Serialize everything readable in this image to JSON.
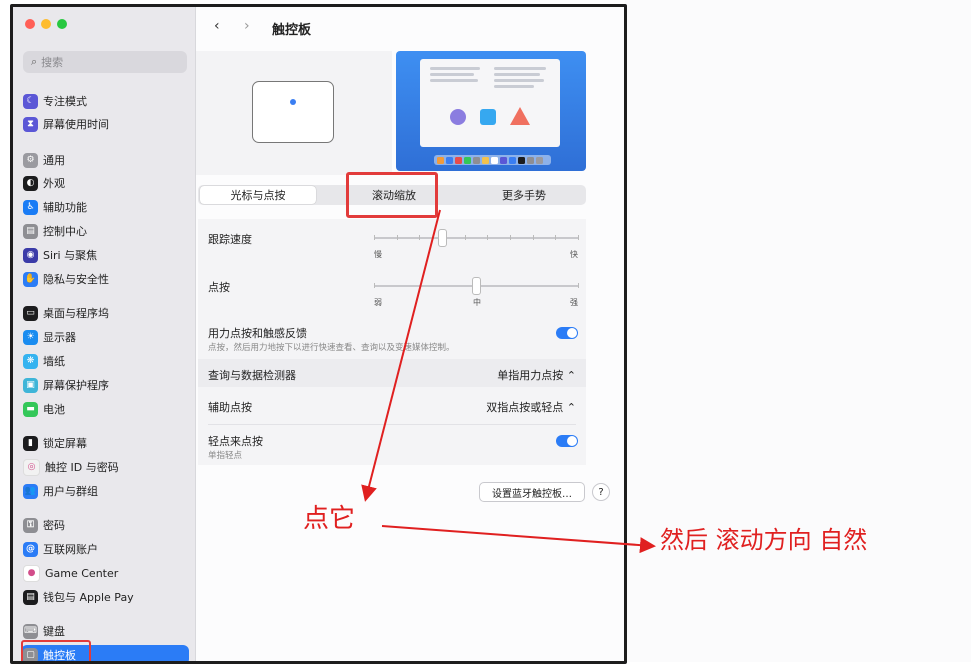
{
  "window": {
    "traffic_colors": [
      "#ff5f57",
      "#febc2e",
      "#28c840"
    ]
  },
  "sidebar": {
    "search_placeholder": "搜索",
    "items": [
      {
        "label": "专注模式",
        "icon": "moon-icon",
        "color": "#5b57d6",
        "glyph": "☾"
      },
      {
        "label": "屏幕使用时间",
        "icon": "hourglass-icon",
        "color": "#5b57d6",
        "glyph": "⧗"
      },
      {
        "label": "通用",
        "icon": "gear-icon",
        "color": "#9a9aa0",
        "glyph": "⚙"
      },
      {
        "label": "外观",
        "icon": "appearance-icon",
        "color": "#1c1c1e",
        "glyph": "◐"
      },
      {
        "label": "辅助功能",
        "icon": "accessibility-icon",
        "color": "#1a7cf5",
        "glyph": "♿"
      },
      {
        "label": "控制中心",
        "icon": "control-center-icon",
        "color": "#8e8e93",
        "glyph": "▤"
      },
      {
        "label": "Siri 与聚焦",
        "icon": "siri-icon",
        "color": "#3b3ba8",
        "glyph": "◉"
      },
      {
        "label": "隐私与安全性",
        "icon": "hand-icon",
        "color": "#2b7cf6",
        "glyph": "✋"
      },
      {
        "label": "桌面与程序坞",
        "icon": "dock-icon",
        "color": "#1c1c1e",
        "glyph": "▭"
      },
      {
        "label": "显示器",
        "icon": "display-icon",
        "color": "#1a8cf0",
        "glyph": "☀"
      },
      {
        "label": "墙纸",
        "icon": "wallpaper-icon",
        "color": "#35b3f0",
        "glyph": "❋"
      },
      {
        "label": "屏幕保护程序",
        "icon": "screensaver-icon",
        "color": "#3fb5d8",
        "glyph": "▣"
      },
      {
        "label": "电池",
        "icon": "battery-icon",
        "color": "#34c759",
        "glyph": "▬"
      },
      {
        "label": "锁定屏幕",
        "icon": "lock-screen-icon",
        "color": "#1c1c1e",
        "glyph": "▮"
      },
      {
        "label": "触控 ID 与密码",
        "icon": "fingerprint-icon",
        "color": "#f2f2f2",
        "glyph": "◎"
      },
      {
        "label": "用户与群组",
        "icon": "users-icon",
        "color": "#2b7cf6",
        "glyph": "👥"
      },
      {
        "label": "密码",
        "icon": "key-icon",
        "color": "#8e8e93",
        "glyph": "⚿"
      },
      {
        "label": "互联网账户",
        "icon": "at-icon",
        "color": "#2b7cf6",
        "glyph": "@"
      },
      {
        "label": "Game Center",
        "icon": "game-center-icon",
        "color": "#ffffff",
        "glyph": "●"
      },
      {
        "label": "钱包与 Apple Pay",
        "icon": "wallet-icon",
        "color": "#1c1c1e",
        "glyph": "▤"
      },
      {
        "label": "键盘",
        "icon": "keyboard-icon",
        "color": "#8e8e93",
        "glyph": "⌨"
      },
      {
        "label": "触控板",
        "icon": "trackpad-icon",
        "color": "#8e8e93",
        "glyph": "▢",
        "active": true
      }
    ]
  },
  "header": {
    "back": "‹",
    "forward": "›",
    "title": "触控板"
  },
  "tabs": [
    {
      "label": "光标与点按",
      "selected": true
    },
    {
      "label": "滚动缩放",
      "selected": false
    },
    {
      "label": "更多手势",
      "selected": false
    }
  ],
  "settings": {
    "tracking_speed": {
      "label": "跟踪速度",
      "min_label": "慢",
      "max_label": "快",
      "value": 0.34
    },
    "click": {
      "label": "点按",
      "min_label": "弱",
      "mid_label": "中",
      "max_label": "强",
      "value": 0.5
    },
    "force_click": {
      "label": "用力点按和触感反馈",
      "sub": "点按，然后用力地按下以进行快速查看、查询以及变速媒体控制。",
      "on": true
    },
    "lookup": {
      "label": "查询与数据检测器",
      "value": "单指用力点按 ⌃"
    },
    "secondary_click": {
      "label": "辅助点按",
      "value": "双指点按或轻点 ⌃"
    },
    "tap_to_click": {
      "label": "轻点来点按",
      "sub": "单指轻点",
      "on": true
    },
    "bluetooth_button": "设置蓝牙触控板…",
    "help": "?"
  },
  "annotations": {
    "click_it": "点它",
    "then": "然后 滚动方向 自然",
    "color": "#e02020"
  }
}
